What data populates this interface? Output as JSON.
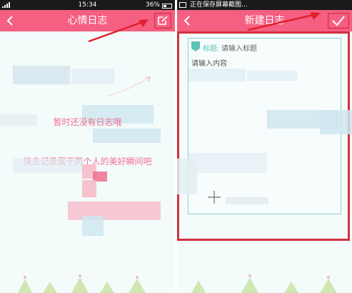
{
  "left_screen": {
    "status": {
      "time": "15:34",
      "battery": "36%"
    },
    "header": {
      "title": "心情日志",
      "back_icon": "chevron-left-icon",
      "action_icon": "edit-icon"
    },
    "empty_state": {
      "line1": "暂时还没有日志哦",
      "line2": "快去记录属于两个人的美好瞬间吧"
    }
  },
  "right_screen": {
    "status": {
      "notification": "正在保存屏幕截图..."
    },
    "header": {
      "title": "新建日志",
      "back_icon": "chevron-left-icon",
      "action_icon": "checkmark-icon"
    },
    "editor": {
      "title_label": "标题:",
      "title_placeholder": "请输入标题",
      "content_placeholder": "请输入内容",
      "add_icon": "plus-icon"
    }
  },
  "colors": {
    "header": "#f55f82",
    "highlight": "#d3313b",
    "accent": "#5cc3b7",
    "empty_text": "#f26e8f"
  }
}
